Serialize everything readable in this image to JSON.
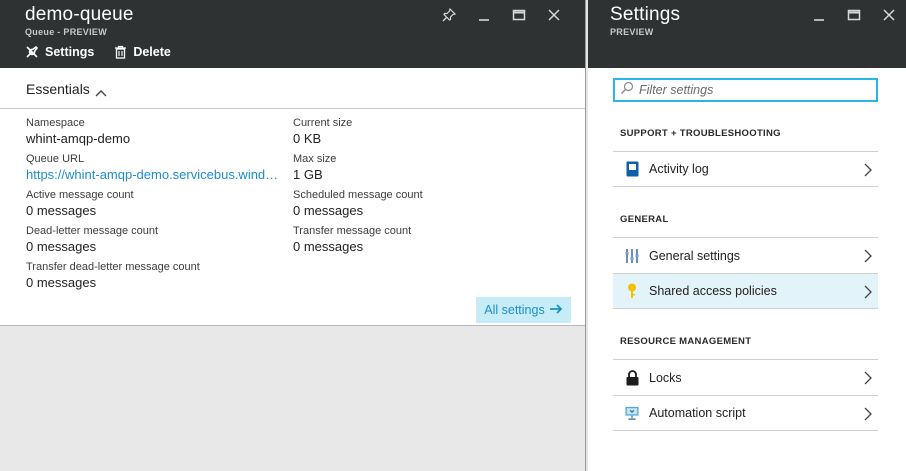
{
  "left_blade": {
    "title": "demo-queue",
    "subtitle": "Queue - PREVIEW",
    "commands": {
      "settings": "Settings",
      "delete": "Delete"
    },
    "essentials": {
      "label": "Essentials",
      "left_col": [
        {
          "label": "Namespace",
          "value": "whint-amqp-demo"
        },
        {
          "label": "Queue URL",
          "value": "https://whint-amqp-demo.servicebus.windows.net/demo-queue"
        },
        {
          "label": "Active message count",
          "value": "0 messages"
        },
        {
          "label": "Dead-letter message count",
          "value": "0 messages"
        },
        {
          "label": "Transfer dead-letter message count",
          "value": "0 messages"
        }
      ],
      "right_col": [
        {
          "label": "Current size",
          "value": "0 KB"
        },
        {
          "label": "Max size",
          "value": "1 GB"
        },
        {
          "label": "Scheduled message count",
          "value": "0 messages"
        },
        {
          "label": "Transfer message count",
          "value": "0 messages"
        }
      ],
      "all_settings": "All settings"
    }
  },
  "right_blade": {
    "title": "Settings",
    "subtitle": "PREVIEW",
    "filter_placeholder": "Filter settings",
    "sections": [
      {
        "title": "SUPPORT + TROUBLESHOOTING",
        "items": [
          {
            "label": "Activity log",
            "icon": "activity-log-icon"
          }
        ]
      },
      {
        "title": "GENERAL",
        "items": [
          {
            "label": "General settings",
            "icon": "sliders-icon"
          },
          {
            "label": "Shared access policies",
            "icon": "key-icon",
            "selected": true
          }
        ]
      },
      {
        "title": "RESOURCE MANAGEMENT",
        "items": [
          {
            "label": "Locks",
            "icon": "lock-icon"
          },
          {
            "label": "Automation script",
            "icon": "automation-script-icon"
          }
        ]
      }
    ]
  },
  "colors": {
    "header": "#2f3233",
    "link": "#1d8ecb",
    "accent": "#29b6e8",
    "selected": "#e3f3fa",
    "key": "#f2c200"
  }
}
